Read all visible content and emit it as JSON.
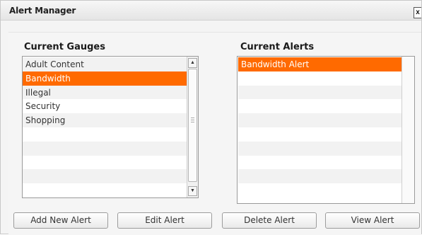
{
  "window": {
    "title": "Alert Manager",
    "close_label": "x"
  },
  "gauges": {
    "title": "Current Gauges",
    "items": [
      {
        "label": "Adult Content",
        "selected": false
      },
      {
        "label": "Bandwidth",
        "selected": true
      },
      {
        "label": "Illegal",
        "selected": false
      },
      {
        "label": "Security",
        "selected": false
      },
      {
        "label": "Shopping",
        "selected": false
      }
    ],
    "total_rows": 10
  },
  "alerts": {
    "title": "Current Alerts",
    "items": [
      {
        "label": "Bandwidth Alert",
        "selected": true
      }
    ],
    "total_rows": 10
  },
  "buttons": {
    "add": "Add New Alert",
    "edit": "Edit Alert",
    "delete": "Delete Alert",
    "view": "View Alert"
  },
  "colors": {
    "selection": "#ff6a00",
    "alt_row": "#f2f2f2"
  },
  "icons": {
    "close": "close-icon",
    "scroll_up": "arrow-up-icon",
    "scroll_down": "arrow-down-icon"
  }
}
